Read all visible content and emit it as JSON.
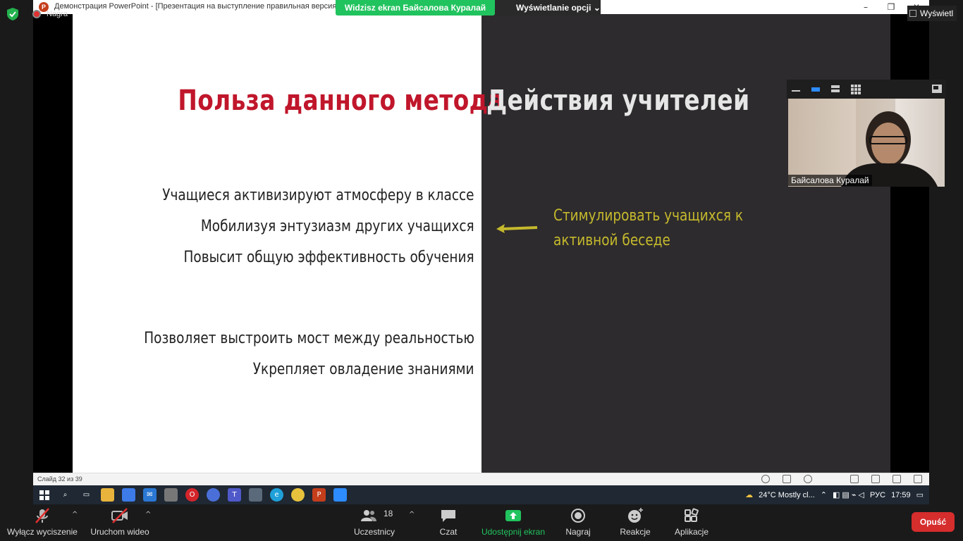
{
  "zoom": {
    "recording_label": "Nagra",
    "view_button": "Wyświetl",
    "banner_viewing": "Widzisz ekran Байсалова Куралай",
    "banner_options": "Wyświetlanie opcji",
    "participant_name": "Байсалова Куралай",
    "participants_count": "18",
    "toolbar": {
      "mute": "Wyłącz wyciszenie",
      "video": "Uruchom wideo",
      "participants": "Uczestnicy",
      "chat": "Czat",
      "share": "Udostępnij ekran",
      "record": "Nagraj",
      "reactions": "Reakcje",
      "apps": "Aplikacje",
      "end": "Opuść"
    },
    "colors": {
      "share_green": "#21c35e",
      "end_red": "#d62d2d"
    }
  },
  "powerpoint": {
    "window_title": "Демонстрация PowerPoint - [Презентация на выступление правильная версия] - PowerPoint",
    "status_slide": "Слайд 32 из 39"
  },
  "slide": {
    "title_left": "Польза данного метода",
    "title_right": "Действия учителей",
    "bullets": [
      "Учащиеся активизируют атмосферу в классе",
      "Мобилизуя энтузиазм других учащихся",
      "Повысит общую эффективность обучения",
      "Позволяет выстроить мост между реальностью",
      "Укрепляет овладение знаниями"
    ],
    "right_note_line1": "Стимулировать учащихся к",
    "right_note_line2": "активной беседе",
    "colors": {
      "title_left": "#c0162b",
      "note": "#c5b92d",
      "right_bg": "#2d2b2d"
    }
  },
  "taskbar": {
    "weather": "24°C  Mostly cl...",
    "language": "РУС",
    "time": "17:59"
  }
}
